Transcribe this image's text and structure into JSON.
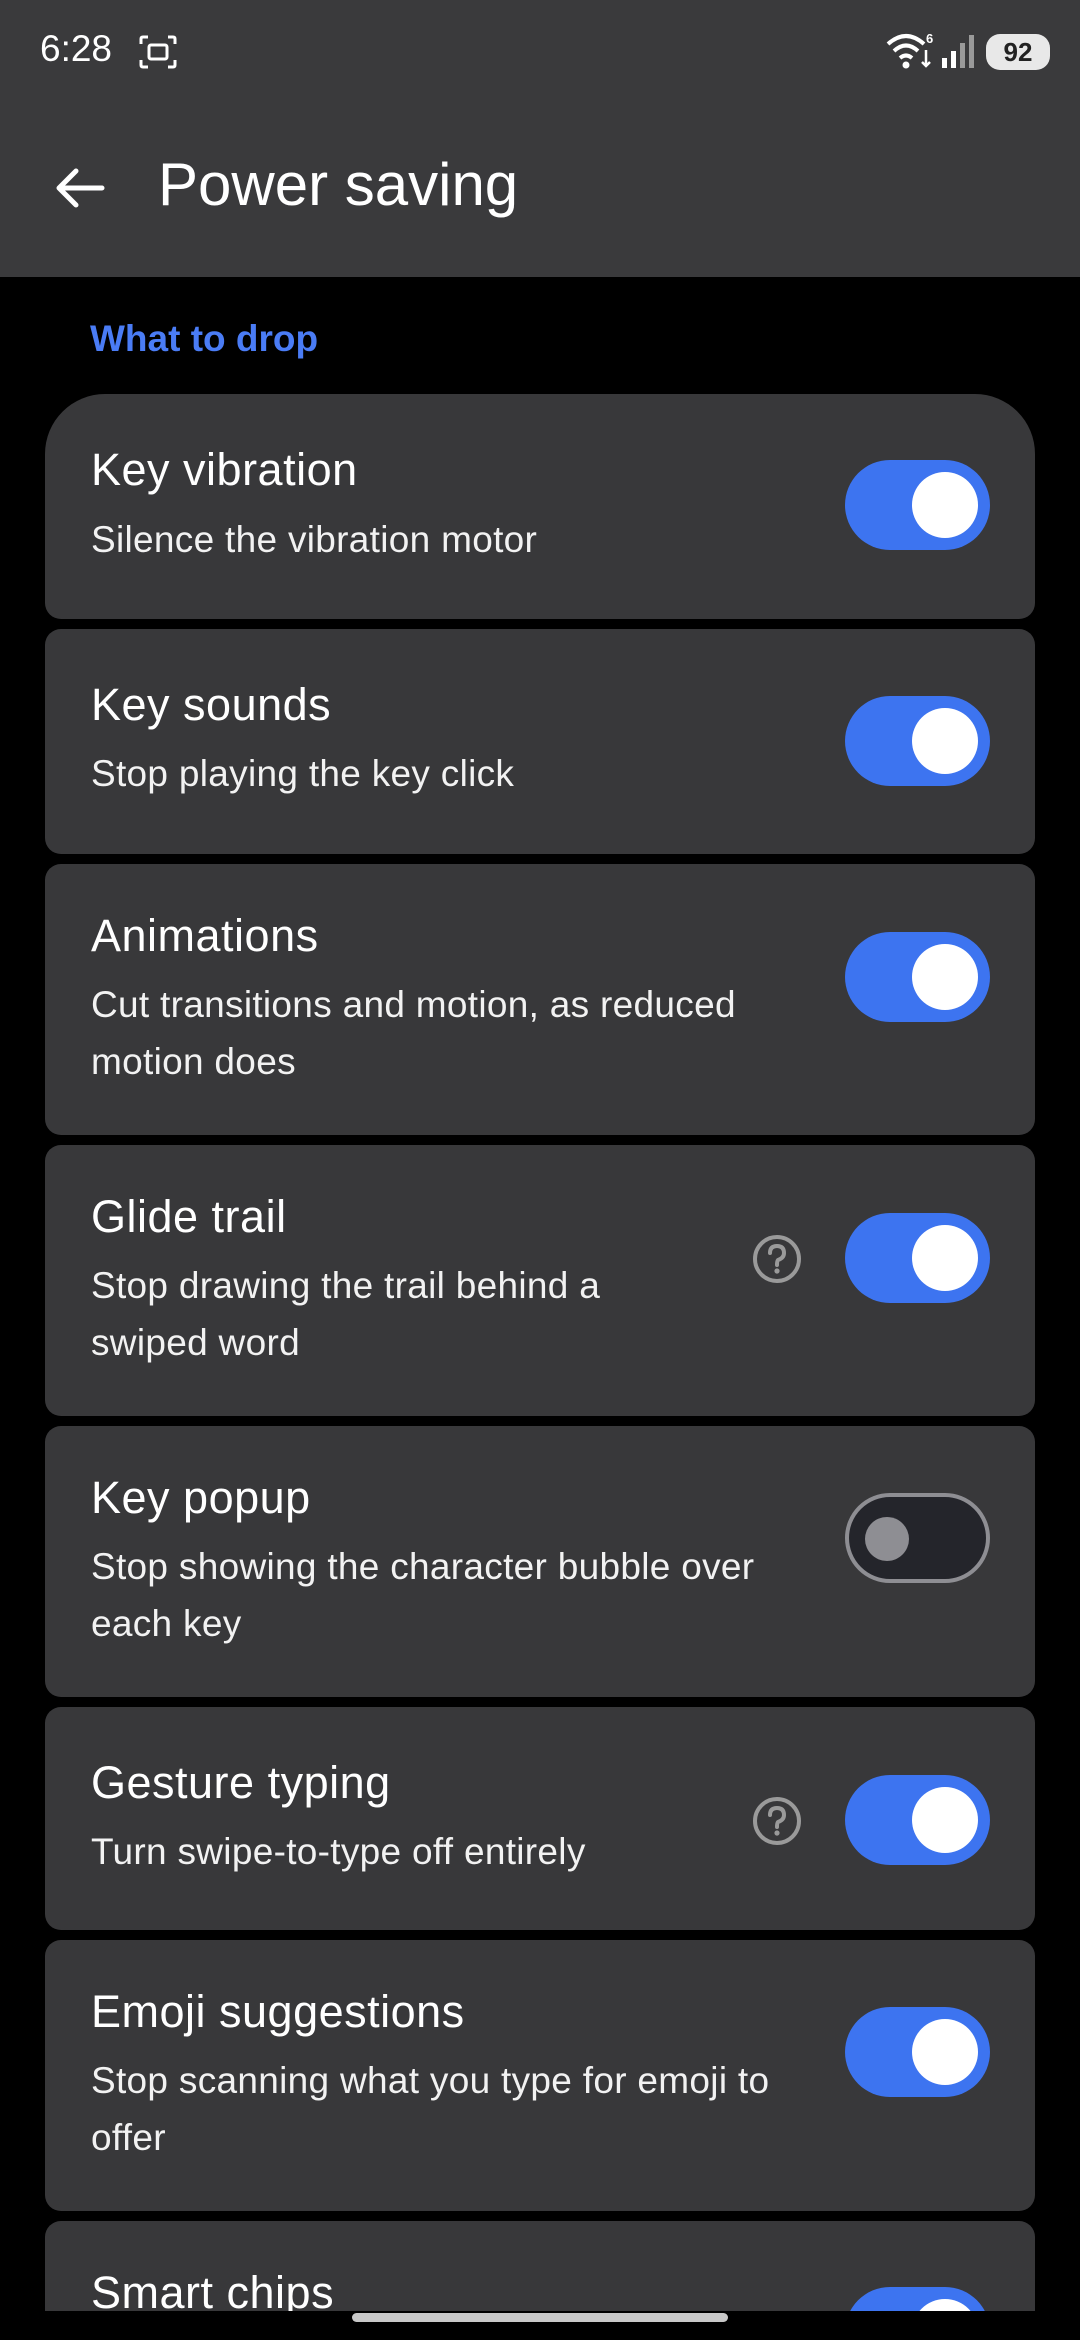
{
  "status_bar": {
    "time": "6:28",
    "battery": "92",
    "network_badge": "6"
  },
  "app_bar": {
    "title": "Power saving",
    "back_icon": "arrow-back-icon"
  },
  "section": {
    "title": "What to drop"
  },
  "settings": [
    {
      "label": "Key vibration",
      "description": "Silence the vibration motor",
      "enabled": true,
      "has_help": false
    },
    {
      "label": "Key sounds",
      "description": "Stop playing the key click",
      "enabled": true,
      "has_help": false
    },
    {
      "label": "Animations",
      "description": "Cut transitions and motion, as reduced motion does",
      "enabled": true,
      "has_help": false
    },
    {
      "label": "Glide trail",
      "description": "Stop drawing the trail behind a swiped word",
      "enabled": true,
      "has_help": true
    },
    {
      "label": "Key popup",
      "description": "Stop showing the character bubble over each key",
      "enabled": false,
      "has_help": false
    },
    {
      "label": "Gesture typing",
      "description": "Turn swipe-to-type off entirely",
      "enabled": true,
      "has_help": true
    },
    {
      "label": "Emoji suggestions",
      "description": "Stop scanning what you type for emoji to offer",
      "enabled": true,
      "has_help": false
    },
    {
      "label": "Smart chips",
      "description": "",
      "enabled": true,
      "has_help": false
    }
  ],
  "colors": {
    "accent": "#4a7cf5",
    "toggle_on": "#3d74f0",
    "card": "#38383a",
    "bar": "#3a3a3c"
  }
}
